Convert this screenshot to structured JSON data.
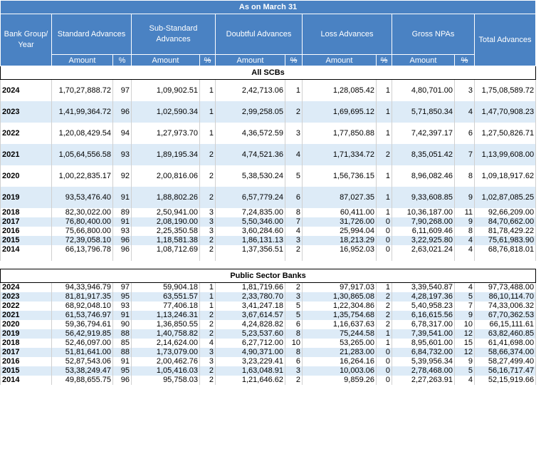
{
  "header": {
    "title": "As on March 31",
    "columns": [
      "Bank Group/ Year",
      "Standard Advances",
      "Sub-Standard Advances",
      "Doubtful Advances",
      "Loss Advances",
      "Gross NPAs",
      "Total Advances"
    ],
    "amount_label": "Amount",
    "percent_label": "%"
  },
  "sections": [
    {
      "name": "All SCBs",
      "rows": [
        {
          "year": "2024",
          "std": "1,70,27,888.72",
          "std_p": "97",
          "sub": "1,09,902.51",
          "sub_p": "1",
          "dbt": "2,42,713.06",
          "dbt_p": "1",
          "loss": "1,28,085.42",
          "loss_p": "1",
          "gnpa": "4,80,701.00",
          "gnpa_p": "3",
          "total": "1,75,08,589.72"
        },
        {
          "year": "2023",
          "std": "1,41,99,364.72",
          "std_p": "96",
          "sub": "1,02,590.34",
          "sub_p": "1",
          "dbt": "2,99,258.05",
          "dbt_p": "2",
          "loss": "1,69,695.12",
          "loss_p": "1",
          "gnpa": "5,71,850.34",
          "gnpa_p": "4",
          "total": "1,47,70,908.23"
        },
        {
          "year": "2022",
          "std": "1,20,08,429.54",
          "std_p": "94",
          "sub": "1,27,973.70",
          "sub_p": "1",
          "dbt": "4,36,572.59",
          "dbt_p": "3",
          "loss": "1,77,850.88",
          "loss_p": "1",
          "gnpa": "7,42,397.17",
          "gnpa_p": "6",
          "total": "1,27,50,826.71"
        },
        {
          "year": "2021",
          "std": "1,05,64,556.58",
          "std_p": "93",
          "sub": "1,89,195.34",
          "sub_p": "2",
          "dbt": "4,74,521.36",
          "dbt_p": "4",
          "loss": "1,71,334.72",
          "loss_p": "2",
          "gnpa": "8,35,051.42",
          "gnpa_p": "7",
          "total": "1,13,99,608.00"
        },
        {
          "year": "2020",
          "std": "1,00,22,835.17",
          "std_p": "92",
          "sub": "2,00,816.06",
          "sub_p": "2",
          "dbt": "5,38,530.24",
          "dbt_p": "5",
          "loss": "1,56,736.15",
          "loss_p": "1",
          "gnpa": "8,96,082.46",
          "gnpa_p": "8",
          "total": "1,09,18,917.62"
        },
        {
          "year": "2019",
          "std": "93,53,476.40",
          "std_p": "91",
          "sub": "1,88,802.26",
          "sub_p": "2",
          "dbt": "6,57,779.24",
          "dbt_p": "6",
          "loss": "87,027.35",
          "loss_p": "1",
          "gnpa": "9,33,608.85",
          "gnpa_p": "9",
          "total": "1,02,87,085.25"
        },
        {
          "year": "2018",
          "std": "82,30,022.00",
          "std_p": "89",
          "sub": "2,50,941.00",
          "sub_p": "3",
          "dbt": "7,24,835.00",
          "dbt_p": "8",
          "loss": "60,411.00",
          "loss_p": "1",
          "gnpa": "10,36,187.00",
          "gnpa_p": "11",
          "total": "92,66,209.00"
        },
        {
          "year": "2017",
          "std": "76,80,400.00",
          "std_p": "91",
          "sub": "2,08,190.00",
          "sub_p": "3",
          "dbt": "5,50,346.00",
          "dbt_p": "7",
          "loss": "31,726.00",
          "loss_p": "0",
          "gnpa": "7,90,268.00",
          "gnpa_p": "9",
          "total": "84,70,662.00"
        },
        {
          "year": "2016",
          "std": "75,66,800.00",
          "std_p": "93",
          "sub": "2,25,350.58",
          "sub_p": "3",
          "dbt": "3,60,284.60",
          "dbt_p": "4",
          "loss": "25,994.04",
          "loss_p": "0",
          "gnpa": "6,11,609.46",
          "gnpa_p": "8",
          "total": "81,78,429.22"
        },
        {
          "year": "2015",
          "std": "72,39,058.10",
          "std_p": "96",
          "sub": "1,18,581.38",
          "sub_p": "2",
          "dbt": "1,86,131.13",
          "dbt_p": "3",
          "loss": "18,213.29",
          "loss_p": "0",
          "gnpa": "3,22,925.80",
          "gnpa_p": "4",
          "total": "75,61,983.90"
        },
        {
          "year": "2014",
          "std": "66,13,796.78",
          "std_p": "96",
          "sub": "1,08,712.69",
          "sub_p": "2",
          "dbt": "1,37,356.51",
          "dbt_p": "2",
          "loss": "16,952.03",
          "loss_p": "0",
          "gnpa": "2,63,021.24",
          "gnpa_p": "4",
          "total": "68,76,818.01"
        }
      ]
    },
    {
      "name": "Public Sector Banks",
      "rows": [
        {
          "year": "2024",
          "std": "94,33,946.79",
          "std_p": "97",
          "sub": "59,904.18",
          "sub_p": "1",
          "dbt": "1,81,719.66",
          "dbt_p": "2",
          "loss": "97,917.03",
          "loss_p": "1",
          "gnpa": "3,39,540.87",
          "gnpa_p": "4",
          "total": "97,73,488.00"
        },
        {
          "year": "2023",
          "std": "81,81,917.35",
          "std_p": "95",
          "sub": "63,551.57",
          "sub_p": "1",
          "dbt": "2,33,780.70",
          "dbt_p": "3",
          "loss": "1,30,865.08",
          "loss_p": "2",
          "gnpa": "4,28,197.36",
          "gnpa_p": "5",
          "total": "86,10,114.70"
        },
        {
          "year": "2022",
          "std": "68,92,048.10",
          "std_p": "93",
          "sub": "77,406.18",
          "sub_p": "1",
          "dbt": "3,41,247.18",
          "dbt_p": "5",
          "loss": "1,22,304.86",
          "loss_p": "2",
          "gnpa": "5,40,958.23",
          "gnpa_p": "7",
          "total": "74,33,006.32"
        },
        {
          "year": "2021",
          "std": "61,53,746.97",
          "std_p": "91",
          "sub": "1,13,246.31",
          "sub_p": "2",
          "dbt": "3,67,614.57",
          "dbt_p": "5",
          "loss": "1,35,754.68",
          "loss_p": "2",
          "gnpa": "6,16,615.56",
          "gnpa_p": "9",
          "total": "67,70,362.53"
        },
        {
          "year": "2020",
          "std": "59,36,794.61",
          "std_p": "90",
          "sub": "1,36,850.55",
          "sub_p": "2",
          "dbt": "4,24,828.82",
          "dbt_p": "6",
          "loss": "1,16,637.63",
          "loss_p": "2",
          "gnpa": "6,78,317.00",
          "gnpa_p": "10",
          "total": "66,15,111.61"
        },
        {
          "year": "2019",
          "std": "56,42,919.85",
          "std_p": "88",
          "sub": "1,40,758.82",
          "sub_p": "2",
          "dbt": "5,23,537.60",
          "dbt_p": "8",
          "loss": "75,244.58",
          "loss_p": "1",
          "gnpa": "7,39,541.00",
          "gnpa_p": "12",
          "total": "63,82,460.85"
        },
        {
          "year": "2018",
          "std": "52,46,097.00",
          "std_p": "85",
          "sub": "2,14,624.00",
          "sub_p": "4",
          "dbt": "6,27,712.00",
          "dbt_p": "10",
          "loss": "53,265.00",
          "loss_p": "1",
          "gnpa": "8,95,601.00",
          "gnpa_p": "15",
          "total": "61,41,698.00"
        },
        {
          "year": "2017",
          "std": "51,81,641.00",
          "std_p": "88",
          "sub": "1,73,079.00",
          "sub_p": "3",
          "dbt": "4,90,371.00",
          "dbt_p": "8",
          "loss": "21,283.00",
          "loss_p": "0",
          "gnpa": "6,84,732.00",
          "gnpa_p": "12",
          "total": "58,66,374.00"
        },
        {
          "year": "2016",
          "std": "52,87,543.06",
          "std_p": "91",
          "sub": "2,00,462.76",
          "sub_p": "3",
          "dbt": "3,23,229.41",
          "dbt_p": "6",
          "loss": "16,264.16",
          "loss_p": "0",
          "gnpa": "5,39,956.34",
          "gnpa_p": "9",
          "total": "58,27,499.40"
        },
        {
          "year": "2015",
          "std": "53,38,249.47",
          "std_p": "95",
          "sub": "1,05,416.03",
          "sub_p": "2",
          "dbt": "1,63,048.91",
          "dbt_p": "3",
          "loss": "10,003.06",
          "loss_p": "0",
          "gnpa": "2,78,468.00",
          "gnpa_p": "5",
          "total": "56,16,717.47"
        },
        {
          "year": "2014",
          "std": "49,88,655.75",
          "std_p": "96",
          "sub": "95,758.03",
          "sub_p": "2",
          "dbt": "1,21,646.62",
          "dbt_p": "2",
          "loss": "9,859.26",
          "loss_p": "0",
          "gnpa": "2,27,263.91",
          "gnpa_p": "4",
          "total": "52,15,919.66"
        }
      ]
    }
  ]
}
